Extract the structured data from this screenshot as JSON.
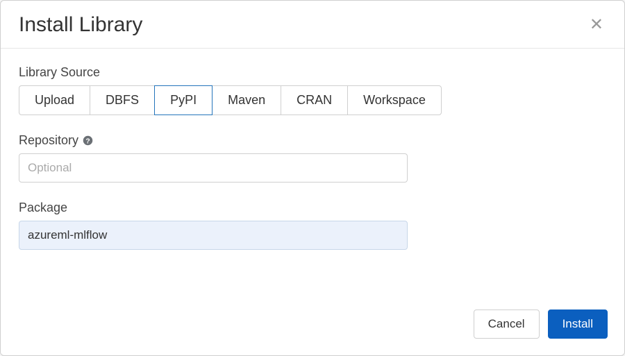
{
  "header": {
    "title": "Install Library"
  },
  "librarySource": {
    "label": "Library Source",
    "options": [
      "Upload",
      "DBFS",
      "PyPI",
      "Maven",
      "CRAN",
      "Workspace"
    ],
    "selected": "PyPI"
  },
  "repository": {
    "label": "Repository",
    "placeholder": "Optional",
    "value": ""
  },
  "package": {
    "label": "Package",
    "value": "azureml-mlflow"
  },
  "footer": {
    "cancel": "Cancel",
    "install": "Install"
  }
}
